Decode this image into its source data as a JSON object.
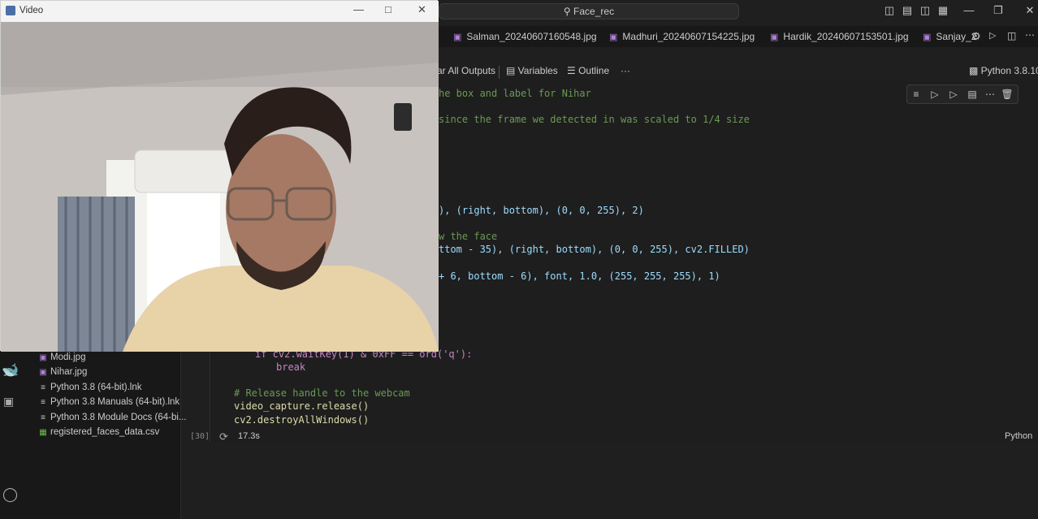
{
  "titlebar": {
    "search_text": "Face_rec"
  },
  "tabs": [
    {
      "label": "Salman_20240607160548.jpg"
    },
    {
      "label": "Madhuri_20240607154225.jpg"
    },
    {
      "label": "Hardik_20240607153501.jpg"
    },
    {
      "label": "Sanjay_2"
    }
  ],
  "notebook_toolbar": {
    "clear_outputs": "ar All Outputs",
    "variables": "Variables",
    "outline": "Outline",
    "more": "···",
    "kernel": "Python 3.8.10"
  },
  "code_lines": [
    {
      "comment": "he box and label for Nihar"
    },
    {
      "comment": "since the frame we detected in was scaled to 1/4 size"
    },
    {
      "text": "), (right, bottom), (0, 0, 255), 2)"
    },
    {
      "comment": "w the face"
    },
    {
      "text": "ttom - 35), (right, bottom), (0, 0, 255), cv2.FILLED)"
    },
    {
      "text": "+ 6, bottom - 6), font, 1.0, (255, 255, 255), 1)"
    },
    {
      "text": "if cv2.waitKey(1) & 0xFF == ord('q'):"
    },
    {
      "text": "break"
    },
    {
      "comment": "# Release handle to the webcam"
    },
    {
      "text": "video_capture.release()"
    },
    {
      "text": "cv2.destroyAllWindows()"
    }
  ],
  "cell_status": {
    "exec_count": "[30]",
    "time": "17.3s",
    "language": "Python"
  },
  "sidebar_files": [
    {
      "name": "Modi.jpg",
      "icon": "image-icon"
    },
    {
      "name": "Nihar.jpg",
      "icon": "image-icon"
    },
    {
      "name": "Python 3.8 (64-bit).lnk",
      "icon": "file-icon"
    },
    {
      "name": "Python 3.8 Manuals (64-bit).lnk",
      "icon": "file-icon"
    },
    {
      "name": "Python 3.8 Module Docs (64-bi...",
      "icon": "file-icon"
    },
    {
      "name": "registered_faces_data.csv",
      "icon": "csv-icon"
    }
  ],
  "video_window": {
    "title": "Video"
  },
  "colors": {
    "accent": "#b180d7",
    "comment": "#6a9955",
    "function": "#dcdcaa",
    "variable": "#9cdcfe"
  }
}
